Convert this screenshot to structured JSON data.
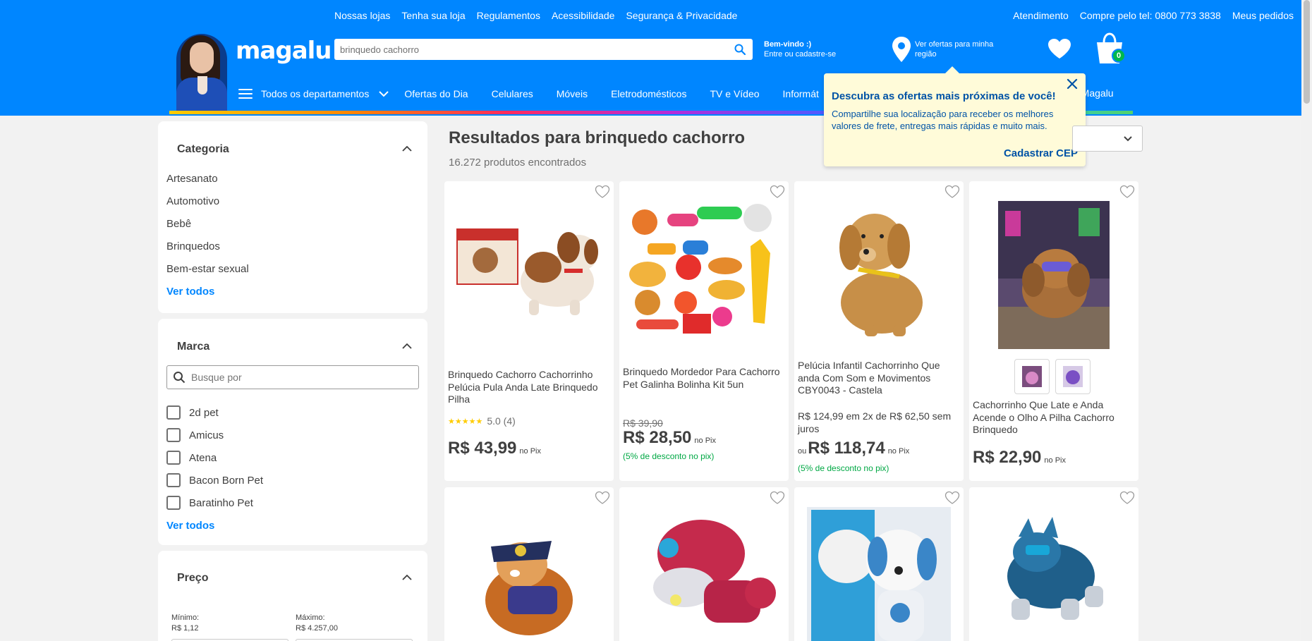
{
  "header": {
    "top_links_left": [
      "Nossas lojas",
      "Tenha sua loja",
      "Regulamentos",
      "Acessibilidade",
      "Segurança & Privacidade"
    ],
    "top_links_right": [
      "Atendimento",
      "Compre pelo tel: 0800 773 3838",
      "Meus pedidos"
    ],
    "logo": "magalu",
    "search_value": "brinquedo cachorro",
    "welcome_title": "Bem-vindo :)",
    "welcome_sub": "Entre ou cadastre-se",
    "location_text": "Ver ofertas para minha região",
    "cart_count": "0",
    "nav_departments": "Todos os departamentos",
    "nav_items": [
      "Ofertas do Dia",
      "Celulares",
      "Móveis",
      "Eletrodomésticos",
      "TV e Vídeo",
      "Informát"
    ],
    "nav_right": "o Magalu",
    "colors": {
      "primary": "#0086ff",
      "link_dark": "#0053a6",
      "green": "#00a844"
    }
  },
  "tooltip": {
    "title": "Descubra as ofertas mais próximas de você!",
    "text": "Compartilhe sua localização para receber os melhores valores de frete, entregas mais rápidas e muito mais.",
    "cta": "Cadastrar CEP"
  },
  "sidebar": {
    "category": {
      "title": "Categoria",
      "items": [
        "Artesanato",
        "Automotivo",
        "Bebê",
        "Brinquedos",
        "Bem-estar sexual"
      ],
      "see_all": "Ver todos"
    },
    "brand": {
      "title": "Marca",
      "search_placeholder": "Busque por",
      "items": [
        "2d pet",
        "Amicus",
        "Atena",
        "Bacon Born Pet",
        "Baratinho Pet"
      ],
      "see_all": "Ver todos"
    },
    "price": {
      "title": "Preço",
      "min_label": "Mínimo:",
      "min_value": "R$ 1,12",
      "max_label": "Máximo:",
      "max_value": "R$ 4.257,00"
    }
  },
  "results": {
    "title": "Resultados para brinquedo cachorro",
    "count": "16.272 produtos encontrados"
  },
  "products": [
    {
      "title": "Brinquedo Cachorro Cachorrinho Pelúcia Pula Anda Late Brinquedo Pilha",
      "stars": "★★★★★",
      "rating": "5.0 (4)",
      "price": "R$ 43,99",
      "price_suffix": "no Pix"
    },
    {
      "title": "Brinquedo Mordedor Para Cachorro Pet Galinha Bolinha Kit 5un",
      "old_price": "R$ 39,90",
      "price": "R$ 28,50",
      "price_suffix": "no Pix",
      "discount": "(5% de desconto no pix)"
    },
    {
      "title": "Pelúcia Infantil Cachorrinho Que anda Com Som e Movimentos CBY0043 - Castela",
      "installments": "R$ 124,99 em 2x de R$ 62,50 sem juros",
      "prefix": "ou",
      "price": "R$ 118,74",
      "price_suffix": "no Pix",
      "discount": "(5% de desconto no pix)"
    },
    {
      "title": "Cachorrinho Que Late e Anda Acende o Olho A Pilha Cachorro Brinquedo",
      "price": "R$ 22,90",
      "price_suffix": "no Pix"
    }
  ],
  "icons": [
    "search-icon",
    "location-pin-icon",
    "heart-icon",
    "cart-icon",
    "menu-icon",
    "chevron-down-icon",
    "close-icon",
    "chevron-up-icon",
    "favorite-icon"
  ]
}
